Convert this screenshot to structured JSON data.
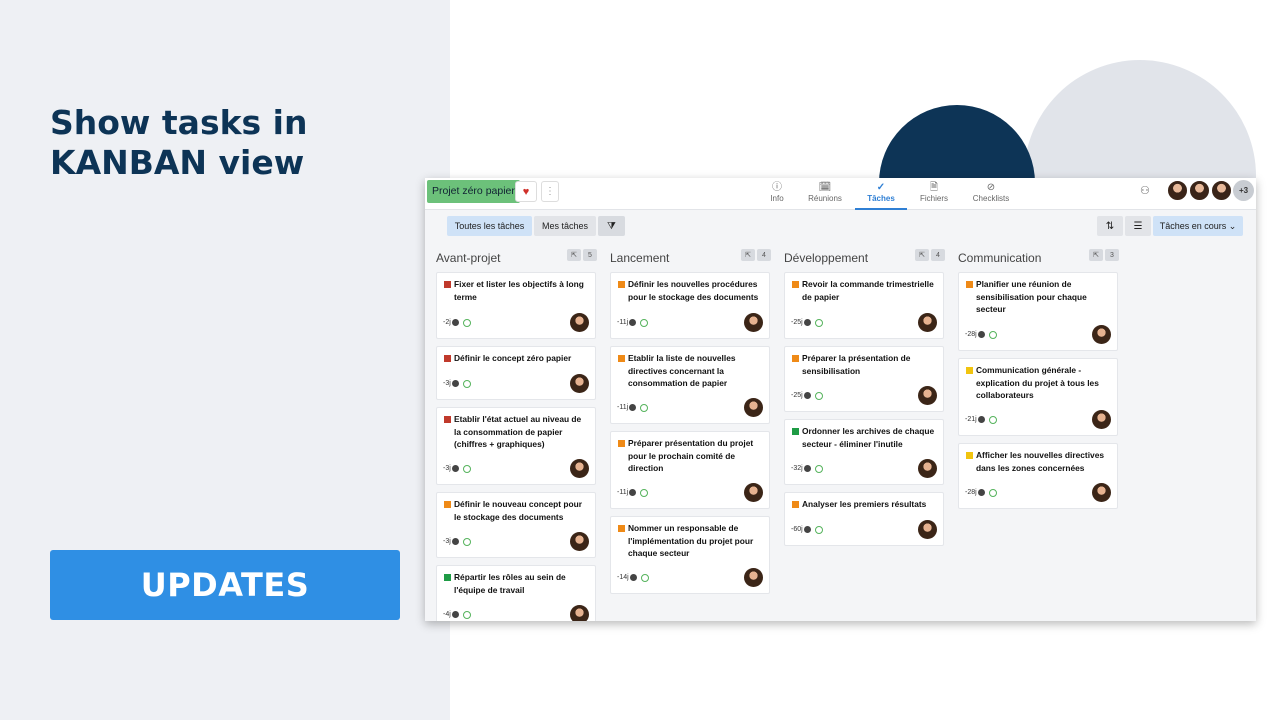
{
  "headline": "Show tasks in\nKANBAN view",
  "updates_button": "UPDATES",
  "colors": {
    "navy": "#0d3456",
    "accent": "#2f8fe4",
    "project_chip": "#6cc17a",
    "priority_high": "#c0392b",
    "priority_medium": "#ef8a17",
    "priority_low": "#f1c40f",
    "priority_done": "#1e9b45"
  },
  "app": {
    "project": "Projet zéro papier",
    "tabs": [
      {
        "label": "Info",
        "icon": "info-icon"
      },
      {
        "label": "Réunions",
        "icon": "calendar-check-icon"
      },
      {
        "label": "Tâches",
        "icon": "check-icon"
      },
      {
        "label": "Fichiers",
        "icon": "file-icon"
      },
      {
        "label": "Checklists",
        "icon": "check-circle-icon"
      }
    ],
    "active_tab": "Tâches",
    "more_members": "+3",
    "filters": {
      "all": "Toutes les tâches",
      "mine": "Mes tâches",
      "status": "Tâches en cours ⌄"
    },
    "columns": [
      {
        "title": "Avant-projet",
        "count": "5",
        "cards": [
          {
            "text": "Fixer et lister les objectifs à long terme",
            "days": "-2j",
            "priority": "high"
          },
          {
            "text": "Définir le concept zéro papier",
            "days": "-3j",
            "priority": "high"
          },
          {
            "text": "Etablir l'état actuel au niveau de la consommation de papier (chiffres + graphiques)",
            "days": "-3j",
            "priority": "high"
          },
          {
            "text": "Définir le nouveau concept pour le stockage des documents",
            "days": "-3j",
            "priority": "medium"
          },
          {
            "text": "Répartir les rôles au sein de l'équipe de travail",
            "days": "-4j",
            "priority": "done"
          }
        ]
      },
      {
        "title": "Lancement",
        "count": "4",
        "cards": [
          {
            "text": "Définir les nouvelles procédures pour le stockage des documents",
            "days": "-11j",
            "priority": "medium"
          },
          {
            "text": "Etablir la liste de nouvelles directives concernant la consommation de papier",
            "days": "-11j",
            "priority": "medium"
          },
          {
            "text": "Préparer présentation du projet pour le prochain comité de direction",
            "days": "-11j",
            "priority": "medium"
          },
          {
            "text": "Nommer un responsable de l'implémentation du projet pour chaque secteur",
            "days": "-14j",
            "priority": "medium"
          }
        ]
      },
      {
        "title": "Développement",
        "count": "4",
        "cards": [
          {
            "text": "Revoir la commande trimestrielle de papier",
            "days": "-25j",
            "priority": "medium"
          },
          {
            "text": "Préparer la présentation de sensibilisation",
            "days": "-25j",
            "priority": "medium"
          },
          {
            "text": "Ordonner les archives de chaque secteur - éliminer l'inutile",
            "days": "-32j",
            "priority": "done"
          },
          {
            "text": "Analyser les premiers résultats",
            "days": "-60j",
            "priority": "medium"
          }
        ]
      },
      {
        "title": "Communication",
        "count": "3",
        "cards": [
          {
            "text": "Planifier une réunion de sensibilisation pour chaque secteur",
            "days": "-28j",
            "priority": "medium"
          },
          {
            "text": "Communication générale - explication du projet à tous les collaborateurs",
            "days": "-21j",
            "priority": "low"
          },
          {
            "text": "Afficher les nouvelles directives dans les zones concernées",
            "days": "-28j",
            "priority": "low"
          }
        ]
      }
    ]
  }
}
